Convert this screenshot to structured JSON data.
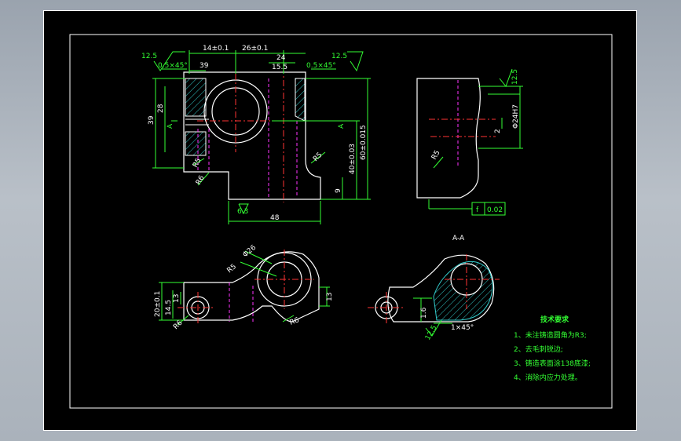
{
  "colors": {
    "background_outer": "#aab2bb",
    "sheet": "#000000",
    "outline": "#ffffff",
    "dimension": "#33ff33",
    "centerline": "#ff3333",
    "hidden_line": "#ff33ff",
    "hatch": "#33cccc"
  },
  "front_view": {
    "top_dims": [
      "14±0.1",
      "26±0.1",
      "24",
      "15.5",
      "39"
    ],
    "surface_left": "12.5",
    "surface_right": "12.5",
    "chamfer_left": "0.5×45°",
    "chamfer_right": "0.5×45°",
    "left_dims": [
      "39",
      "28"
    ],
    "right_dims": [
      "60±0.015",
      "40±0.03",
      "9"
    ],
    "bottom_dim": "48",
    "surface_bottom": "6.3",
    "radius_labels": [
      "R5",
      "R6",
      "R5"
    ],
    "section_marks": [
      "A",
      "A"
    ]
  },
  "side_view": {
    "surface": "12.5",
    "dims": [
      "Φ24H7",
      "2"
    ],
    "radius": "R5",
    "tolerance_symbol": "f",
    "tolerance_value": "0.02"
  },
  "top_view": {
    "dims": [
      "20±0.1",
      "14.5",
      "13",
      "13"
    ],
    "radii": [
      "R5",
      "R6",
      "R6",
      "R5"
    ],
    "diameter": "Φ26"
  },
  "section_view": {
    "title": "A-A",
    "dim": "1.6",
    "chamfer": "1×45°",
    "surface": "12.5"
  },
  "tech_requirements": {
    "title": "技术要求",
    "items": [
      "1、未注铸造圆角为R3;",
      "2、去毛刺锐边;",
      "3、铸造表面涂138底漆;",
      "4、消除内应力处理。"
    ]
  }
}
